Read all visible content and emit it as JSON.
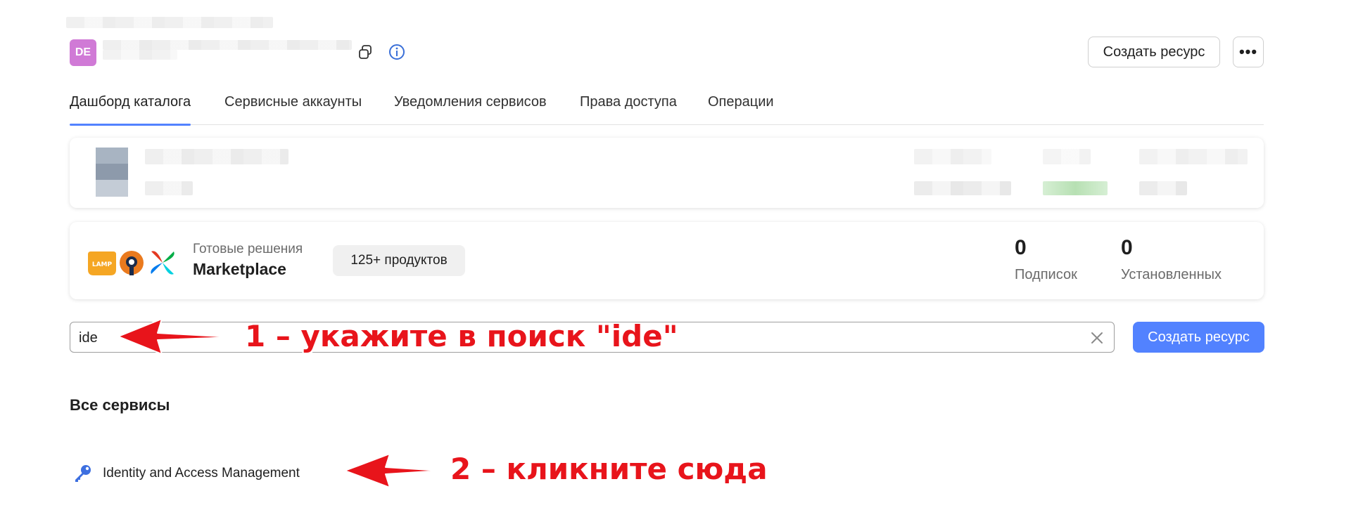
{
  "header": {
    "avatar_initials": "DE",
    "create_resource_label": "Создать ресурс",
    "more_label": "•••"
  },
  "tabs": [
    {
      "label": "Дашборд каталога",
      "active": true
    },
    {
      "label": "Сервисные аккаунты",
      "active": false
    },
    {
      "label": "Уведомления сервисов",
      "active": false
    },
    {
      "label": "Права доступа",
      "active": false
    },
    {
      "label": "Операции",
      "active": false
    }
  ],
  "marketplace": {
    "caption": "Готовые решения",
    "title": "Marketplace",
    "badge": "125+ продуктов",
    "logo_text": "LAMP",
    "stats": [
      {
        "value": "0",
        "label": "Подписок"
      },
      {
        "value": "0",
        "label": "Установленных"
      }
    ]
  },
  "search": {
    "value": "ide",
    "create_resource_label": "Создать ресурс"
  },
  "services": {
    "title": "Все сервисы",
    "items": [
      {
        "label": "Identity and Access Management",
        "icon": "key-icon"
      }
    ]
  },
  "annotations": {
    "step1": "1 – укажите в поиск \"ide\"",
    "step2": "2 – кликните сюда"
  },
  "colors": {
    "accent": "#5282ff",
    "avatar": "#d07ad6",
    "annotation": "#e8141b"
  }
}
